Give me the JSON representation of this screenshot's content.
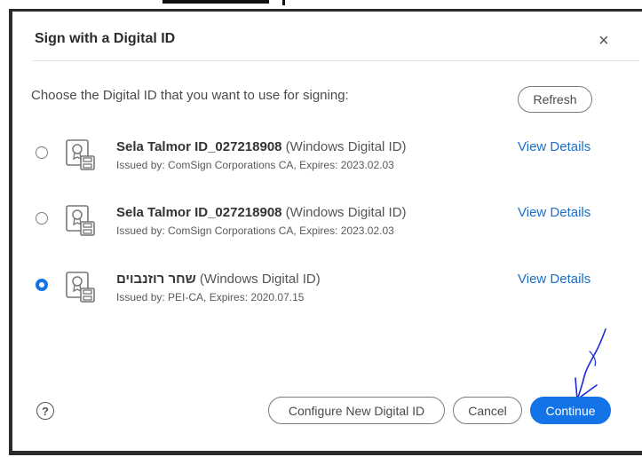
{
  "dialog": {
    "title": "Sign with a Digital ID",
    "close_glyph": "×",
    "prompt": "Choose the Digital ID that you want to use for signing:",
    "refresh_label": "Refresh"
  },
  "ids": [
    {
      "name": "Sela Talmor ID_027218908",
      "type": " (Windows Digital ID)",
      "issued": "Issued by: ComSign Corporations CA, Expires: 2023.02.03",
      "view_label": "View Details",
      "selected": false
    },
    {
      "name": "Sela Talmor ID_027218908",
      "type": " (Windows Digital ID)",
      "issued": "Issued by: ComSign Corporations CA, Expires: 2023.02.03",
      "view_label": "View Details",
      "selected": false
    },
    {
      "name": "שחר רוזנבוים",
      "type": " (Windows Digital ID)",
      "issued": "Issued by: PEI-CA, Expires: 2020.07.15",
      "view_label": "View Details",
      "selected": true
    }
  ],
  "footer": {
    "help_glyph": "?",
    "configure_label": "Configure New Digital ID",
    "cancel_label": "Cancel",
    "continue_label": "Continue"
  },
  "colors": {
    "accent": "#1473e6",
    "link": "#1a6fc9",
    "annotation_arrow": "#1a2ad8"
  },
  "icons": {
    "cert": "certificate-icon",
    "close": "close-icon",
    "help": "help-icon"
  }
}
